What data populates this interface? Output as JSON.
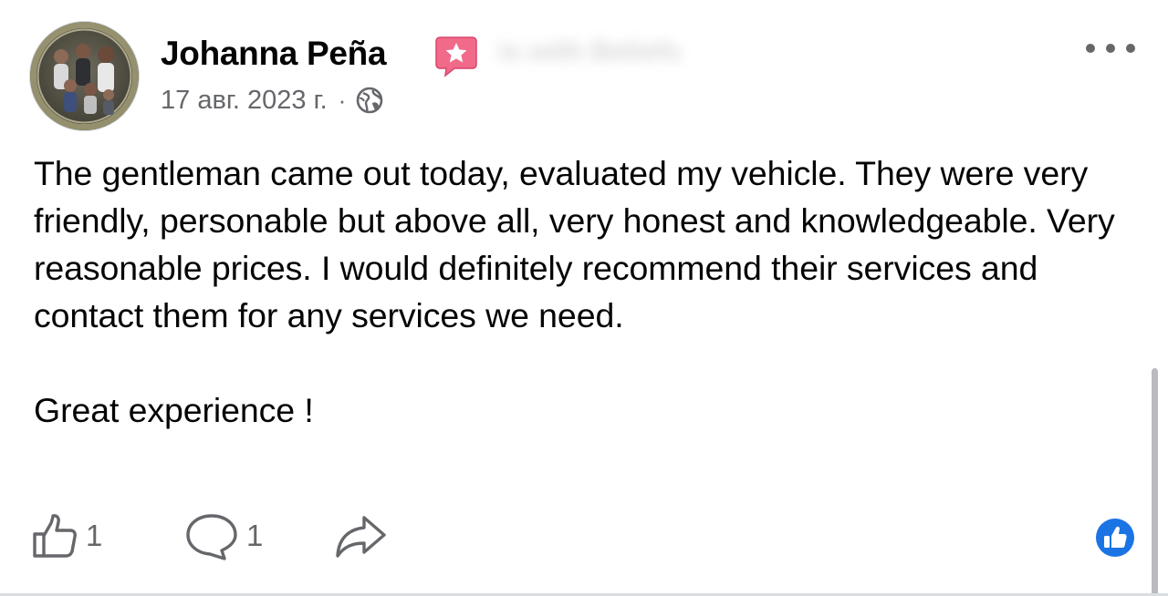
{
  "post": {
    "author": {
      "name": "Johanna Peña",
      "badge_icon": "star-badge-icon",
      "blurred_tag": "is with Beliefs"
    },
    "timestamp": "17 авг. 2023 г.",
    "separator": "·",
    "privacy_icon": "globe-icon",
    "body": {
      "paragraph_1": "The gentleman came out today, evaluated my vehicle. They were very friendly, personable but above all, very honest and knowledgeable. Very reasonable prices. I would definitely recommend their services and contact them for any services we need.",
      "paragraph_2": "Great experience !"
    },
    "actions": {
      "like_count": "1",
      "comment_count": "1"
    }
  },
  "colors": {
    "text": "#050505",
    "secondary_text": "#65676b",
    "badge_pink": "#f16a8a",
    "like_blue": "#1b74e4"
  }
}
